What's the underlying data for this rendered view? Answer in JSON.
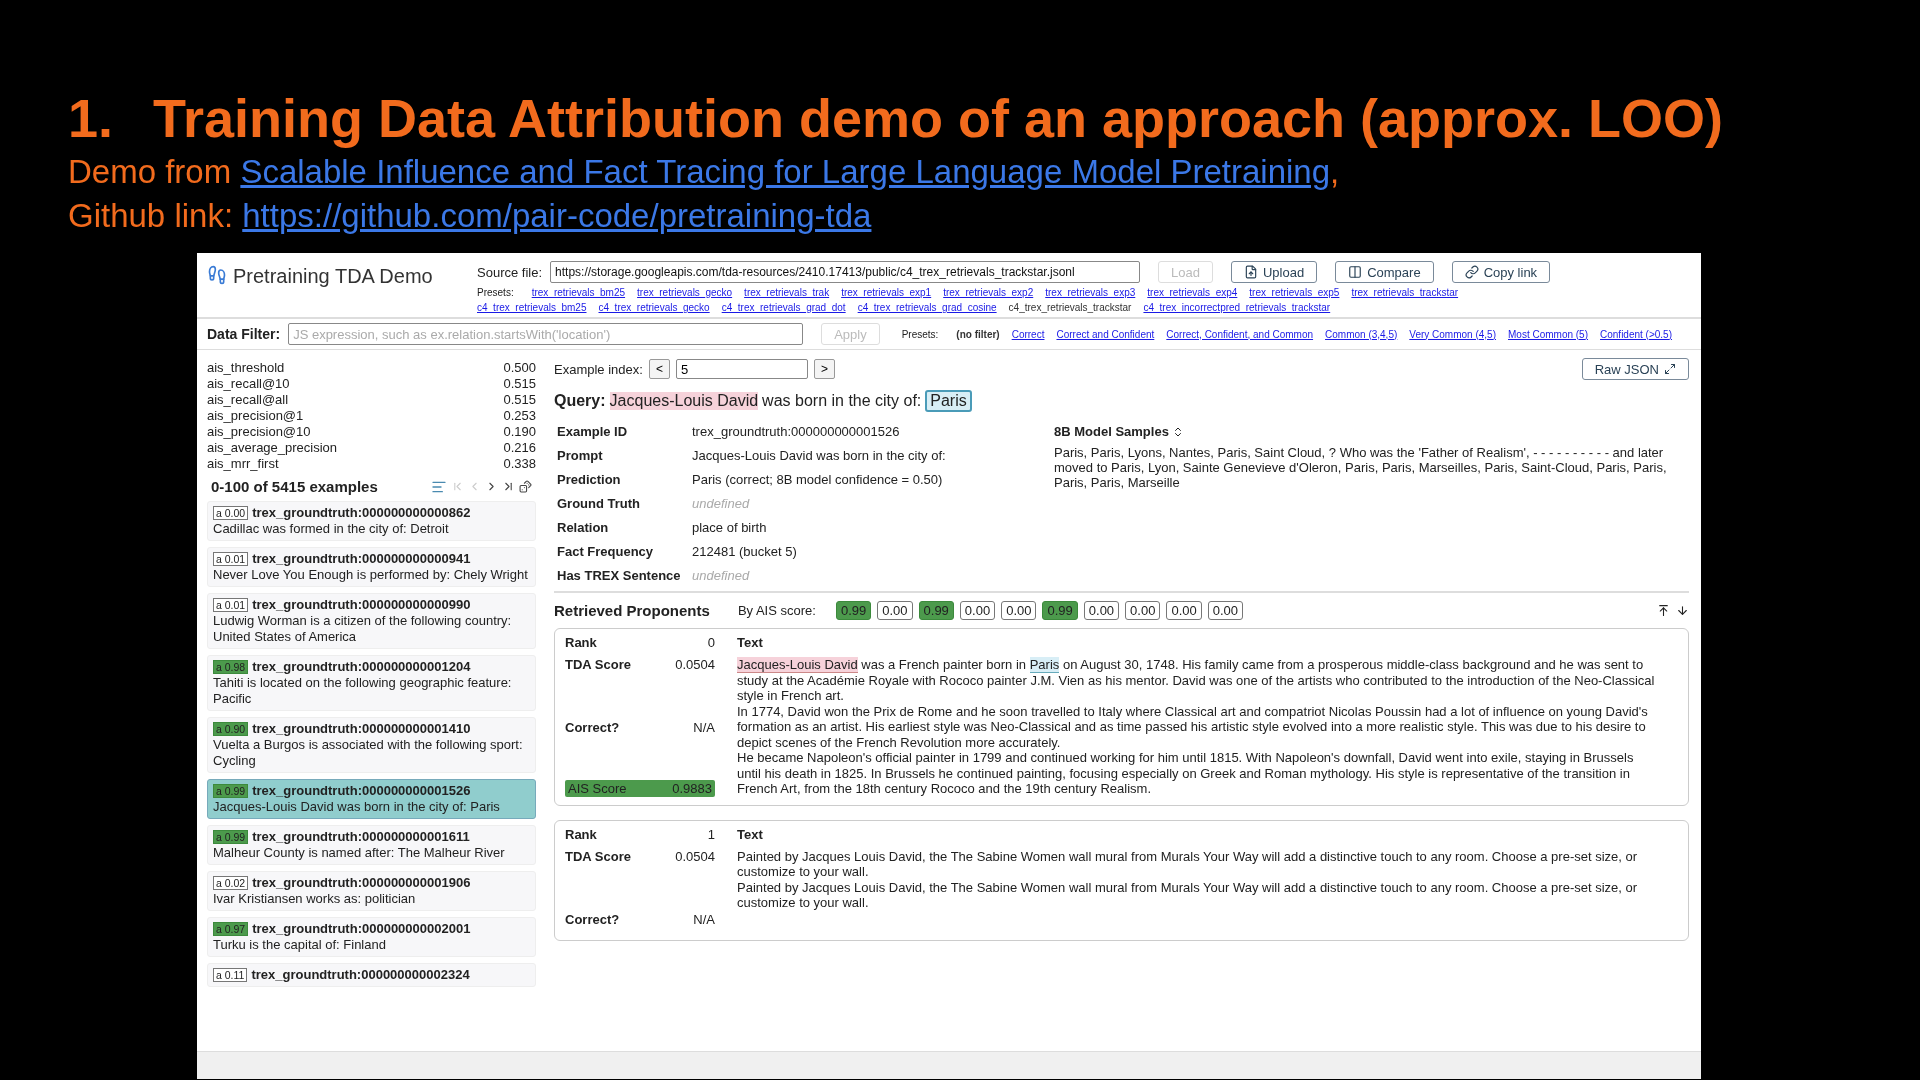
{
  "slide": {
    "number": "1.",
    "title": "Training Data Attribution demo of an approach (approx. LOO)",
    "lines": [
      {
        "label": "Demo from ",
        "link": "Scalable Influence and Fact Tracing for Large Language Model Pretraining",
        "after": ","
      },
      {
        "label": "Github link: ",
        "link": "https://github.com/pair-code/pretraining-tda"
      }
    ]
  },
  "app": {
    "title": "Pretraining TDA Demo",
    "source": {
      "label": "Source file:",
      "value": "https://storage.googleapis.com/tda-resources/2410.17413/public/c4_trex_retrievals_trackstar.jsonl"
    },
    "buttons": [
      {
        "kind": "load",
        "label": "Load",
        "disabled": true
      },
      {
        "kind": "upload",
        "label": "Upload",
        "disabled": false
      },
      {
        "kind": "compare",
        "label": "Compare",
        "disabled": false
      },
      {
        "kind": "link",
        "label": "Copy link",
        "disabled": false
      }
    ],
    "presets_label": "Presets:",
    "presets": [
      [
        {
          "label": "trex_retrievals_bm25",
          "selected": false
        },
        {
          "label": "trex_retrievals_gecko",
          "selected": false
        },
        {
          "label": "trex_retrievals_trak",
          "selected": false
        },
        {
          "label": "trex_retrievals_exp1",
          "selected": false
        },
        {
          "label": "trex_retrievals_exp2",
          "selected": false
        },
        {
          "label": "trex_retrievals_exp3",
          "selected": false
        },
        {
          "label": "trex_retrievals_exp4",
          "selected": false
        },
        {
          "label": "trex_retrievals_exp5",
          "selected": false
        },
        {
          "label": "trex_retrievals_trackstar",
          "selected": false
        }
      ],
      [
        {
          "label": "c4_trex_retrievals_bm25",
          "selected": false
        },
        {
          "label": "c4_trex_retrievals_gecko",
          "selected": false
        },
        {
          "label": "c4_trex_retrievals_grad_dot",
          "selected": false
        },
        {
          "label": "c4_trex_retrievals_grad_cosine",
          "selected": false
        },
        {
          "label": "c4_trex_retrievals_trackstar",
          "selected": true
        },
        {
          "label": "c4_trex_incorrectpred_retrievals_trackstar",
          "selected": false
        }
      ]
    ],
    "filter": {
      "label": "Data Filter:",
      "placeholder": "JS expression, such as ex.relation.startsWith('location')",
      "apply": "Apply",
      "apply_disabled": true,
      "presets_label": "Presets:",
      "presets": [
        {
          "label": "(no filter)",
          "selected": true
        },
        {
          "label": "Correct",
          "selected": false
        },
        {
          "label": "Correct and Confident",
          "selected": false
        },
        {
          "label": "Correct, Confident, and Common",
          "selected": false
        },
        {
          "label": "Common (3,4,5)",
          "selected": false
        },
        {
          "label": "Very Common (4,5)",
          "selected": false
        },
        {
          "label": "Most Common (5)",
          "selected": false
        },
        {
          "label": "Confident (>0.5)",
          "selected": false
        }
      ]
    },
    "metrics": [
      {
        "name": "ais_threshold",
        "value": "0.500"
      },
      {
        "name": "ais_recall@10",
        "value": "0.515"
      },
      {
        "name": "ais_recall@all",
        "value": "0.515"
      },
      {
        "name": "ais_precision@1",
        "value": "0.253"
      },
      {
        "name": "ais_precision@10",
        "value": "0.190"
      },
      {
        "name": "ais_average_precision",
        "value": "0.216"
      },
      {
        "name": "ais_mrr_first",
        "value": "0.338"
      }
    ],
    "examples": {
      "title": "0-100 of 5415 examples",
      "items": [
        {
          "score": "a 0.00",
          "passed": false,
          "id": "trex_groundtruth:000000000000862",
          "text": "Cadillac was formed in the city of: Detroit",
          "selected": false
        },
        {
          "score": "a 0.01",
          "passed": false,
          "id": "trex_groundtruth:000000000000941",
          "text": "Never Love You Enough is performed by: Chely Wright",
          "selected": false
        },
        {
          "score": "a 0.01",
          "passed": false,
          "id": "trex_groundtruth:000000000000990",
          "text": "Ludwig Worman is a citizen of the following country: United States of America",
          "selected": false
        },
        {
          "score": "a 0.98",
          "passed": true,
          "id": "trex_groundtruth:000000000001204",
          "text": "Tahiti is located on the following geographic feature: Pacific",
          "selected": false
        },
        {
          "score": "a 0.90",
          "passed": true,
          "id": "trex_groundtruth:000000000001410",
          "text": "Vuelta a Burgos is associated with the following sport: Cycling",
          "selected": false
        },
        {
          "score": "a 0.99",
          "passed": true,
          "id": "trex_groundtruth:000000000001526",
          "text": "Jacques-Louis David was born in the city of: Paris",
          "selected": true
        },
        {
          "score": "a 0.99",
          "passed": true,
          "id": "trex_groundtruth:000000000001611",
          "text": "Malheur County is named after: The Malheur River",
          "selected": false
        },
        {
          "score": "a 0.02",
          "passed": false,
          "id": "trex_groundtruth:000000000001906",
          "text": "Ivar Kristiansen works as: politician",
          "selected": false
        },
        {
          "score": "a 0.97",
          "passed": true,
          "id": "trex_groundtruth:000000000002001",
          "text": "Turku is the capital of: Finland",
          "selected": false
        },
        {
          "score": "a 0.11",
          "passed": false,
          "id": "trex_groundtruth:000000000002324",
          "selected": false
        }
      ]
    },
    "index": {
      "label": "Example index:",
      "prev": "<",
      "value": "5",
      "next": ">"
    },
    "raw_json": "Raw JSON",
    "query": {
      "label": "Query:",
      "subject": "Jacques-Louis David",
      "middle": "was born in the city of:",
      "answer": "Paris"
    },
    "fields": [
      {
        "label": "Example ID",
        "value": "trex_groundtruth:000000000001526",
        "muted": false
      },
      {
        "label": "Prompt",
        "value": "Jacques-Louis David was born in the city of:",
        "muted": false
      },
      {
        "label": "Prediction",
        "value": "Paris (correct;  8B model confidence = 0.50)",
        "muted": false
      },
      {
        "label": "Ground Truth",
        "value": "undefined",
        "muted": true
      },
      {
        "label": "Relation",
        "value": "place of birth",
        "muted": false
      },
      {
        "label": "Fact Frequency",
        "value": "212481 (bucket 5)",
        "muted": false
      },
      {
        "label": "Has TREX Sentence",
        "value": "undefined",
        "muted": true
      }
    ],
    "samples": {
      "title": "8B Model Samples",
      "text": "Paris, Paris, Lyons, Nantes, Paris, Saint Cloud, ? Who was the 'Father of Realism', - - - - - - - - - - and later moved to Paris, Lyon, Sainte Genevieve d'Oleron, Paris, Paris, Marseilles, Paris, Saint-Cloud, Paris, Paris, Paris, Paris, Marseille"
    },
    "proponents": {
      "title": "Retrieved Proponents",
      "by_label": "By AIS score:",
      "scores": [
        {
          "value": "0.99",
          "passed": true
        },
        {
          "value": "0.00",
          "passed": false
        },
        {
          "value": "0.99",
          "passed": true
        },
        {
          "value": "0.00",
          "passed": false
        },
        {
          "value": "0.00",
          "passed": false
        },
        {
          "value": "0.99",
          "passed": true
        },
        {
          "value": "0.00",
          "passed": false
        },
        {
          "value": "0.00",
          "passed": false
        },
        {
          "value": "0.00",
          "passed": false
        },
        {
          "value": "0.00",
          "passed": false
        }
      ],
      "cards": [
        {
          "rank_label": "Rank",
          "rank": "0",
          "tda_label": "TDA Score",
          "tda": "0.0504",
          "correct_label": "Correct?",
          "correct": "N/A",
          "ais_label": "AIS Score",
          "ais": "0.9883",
          "ais_passed": true,
          "text_label": "Text",
          "paragraphs": [
            [
              {
                "text": "Jacques-Louis David",
                "kind": "subject"
              },
              {
                "text": " was a French painter born in "
              },
              {
                "text": "Paris",
                "kind": "answer"
              },
              {
                "text": " on August 30, 1748. His family came from a prosperous middle-class background and he was sent to study at the Académie Royale with Rococo painter J.M. Vien as his mentor. David was one of the artists who contributed to the introduction of the Neo-Classical style in French art."
              }
            ],
            [
              {
                "text": "In 1774, David won the Prix de Rome and he soon travelled to Italy where Classical art and compatriot Nicolas Poussin had a lot of influence on young David's formation as an artist. His earliest style was Neo-Classical and as time passed his artistic style evolved into a more realistic style. This was due to his desire to depict scenes of the French Revolution more accurately."
              }
            ],
            [
              {
                "text": "He became Napoleon's official painter in 1799 and continued working for him until 1815. With Napoleon's downfall, David went into exile, staying in Brussels until his death in 1825. In Brussels he continued painting, focusing especially on Greek and Roman mythology. His style is representative of the transition in French Art, from the 18th century Rococo and the 19th century Realism."
              }
            ]
          ]
        },
        {
          "rank_label": "Rank",
          "rank": "1",
          "tda_label": "TDA Score",
          "tda": "0.0504",
          "correct_label": "Correct?",
          "correct": "N/A",
          "text_label": "Text",
          "paragraphs": [
            [
              {
                "text": "Painted by Jacques Louis David, the The Sabine Women wall mural from Murals Your Way will add a distinctive touch to any room. Choose a pre-set size, or customize to your wall."
              }
            ],
            [
              {
                "text": "Painted by Jacques Louis David, the The Sabine Women wall mural from Murals Your Way will add a distinctive touch to any room. Choose a pre-set size, or customize to your wall."
              }
            ]
          ]
        }
      ]
    }
  }
}
